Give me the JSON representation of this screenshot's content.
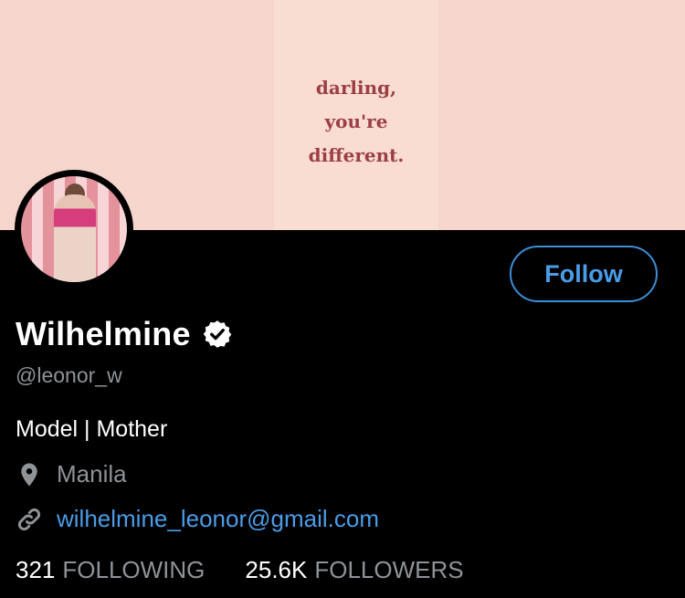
{
  "banner": {
    "quote_lines": [
      "darling,",
      "you're",
      "different."
    ]
  },
  "profile": {
    "name": "Wilhelmine",
    "verified": true,
    "handle": "@leonor_w",
    "bio": "Model | Mother",
    "location": "Manila",
    "link": "wilhelmine_leonor@gmail.com"
  },
  "actions": {
    "follow_label": "Follow"
  },
  "stats": {
    "following_count": "321",
    "following_label": "FOLLOWING",
    "followers_count": "25.6K",
    "followers_label": "FOLLOWERS"
  },
  "icons": {
    "verified": "verified-badge-icon",
    "location": "location-pin-icon",
    "link": "link-chain-icon"
  },
  "colors": {
    "background": "#000000",
    "banner": "#f6d6cc",
    "quote_text": "#9c3f44",
    "accent": "#4a9ce6",
    "muted_text": "#8e9398",
    "primary_text": "#ffffff"
  }
}
